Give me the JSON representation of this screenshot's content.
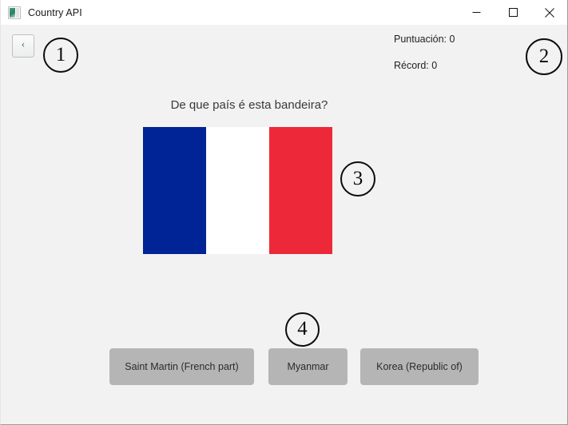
{
  "window": {
    "title": "Country API",
    "icon": "app-window-icon",
    "controls": [
      {
        "name": "minimize",
        "glyph": "minimize-icon"
      },
      {
        "name": "maximize",
        "glyph": "maximize-icon"
      },
      {
        "name": "close",
        "glyph": "close-icon"
      }
    ]
  },
  "toolbar": {
    "back_label": "‹",
    "back_icon": "chevron-left-icon"
  },
  "score": {
    "points_label": "Puntuación: 0",
    "record_label": "Récord: 0"
  },
  "quiz": {
    "question": "De que país é esta bandeira?",
    "flag": {
      "alt": "flag-of-france",
      "bands": [
        {
          "name": "blue-band",
          "color": "#002395"
        },
        {
          "name": "white-band",
          "color": "#FFFFFF"
        },
        {
          "name": "red-band",
          "color": "#ED2939"
        }
      ]
    },
    "answers": [
      {
        "label": "Saint Martin (French part)"
      },
      {
        "label": "Myanmar"
      },
      {
        "label": "Korea (Republic of)"
      }
    ]
  },
  "annotations": [
    {
      "id": "1",
      "label": "①",
      "text": "1"
    },
    {
      "id": "2",
      "label": "②",
      "text": "2"
    },
    {
      "id": "3",
      "label": "③",
      "text": "3"
    },
    {
      "id": "4",
      "label": "④",
      "text": "4"
    }
  ],
  "colors": {
    "window_background": "#F2F2F2",
    "titlebar_background": "#FFFFFF",
    "button_background": "#B5B5B5",
    "flag_blue": "#002395",
    "flag_red": "#ED2939",
    "annotation_ink": "#0C0C0C"
  }
}
